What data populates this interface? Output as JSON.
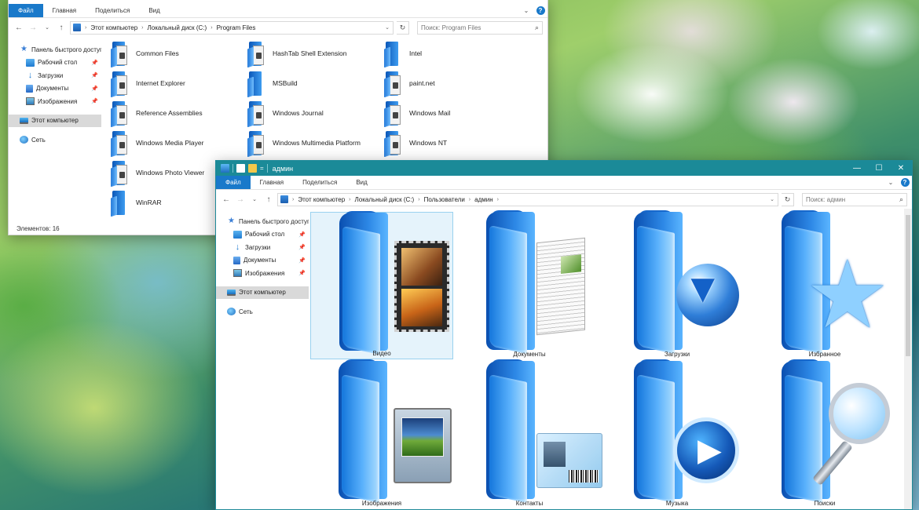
{
  "window1": {
    "tabs": [
      "Файл",
      "Главная",
      "Поделиться",
      "Вид"
    ],
    "path": [
      "Этот компьютер",
      "Локальный диск (C:)",
      "Program Files"
    ],
    "search_placeholder": "Поиск: Program Files",
    "nav": {
      "quick_access": "Панель быстрого доступа",
      "desktop": "Рабочий стол",
      "downloads": "Загрузки",
      "documents": "Документы",
      "pictures": "Изображения",
      "this_pc": "Этот компьютер",
      "network": "Сеть"
    },
    "items": [
      "Common Files",
      "HashTab Shell Extension",
      "Intel",
      "Internet Explorer",
      "MSBuild",
      "paint.net",
      "Reference Assemblies",
      "Windows Journal",
      "Windows Mail",
      "Windows Media Player",
      "Windows Multimedia Platform",
      "Windows NT",
      "Windows Photo Viewer",
      "WinRAR"
    ],
    "status": "Элементов: 16"
  },
  "window2": {
    "title": "админ",
    "tabs": [
      "Файл",
      "Главная",
      "Поделиться",
      "Вид"
    ],
    "path": [
      "Этот компьютер",
      "Локальный диск (C:)",
      "Пользователи",
      "админ"
    ],
    "search_placeholder": "Поиск: админ",
    "nav": {
      "quick_access": "Панель быстрого доступа",
      "desktop": "Рабочий стол",
      "downloads": "Загрузки",
      "documents": "Документы",
      "pictures": "Изображения",
      "this_pc": "Этот компьютер",
      "network": "Сеть"
    },
    "items": [
      "Видео",
      "Документы",
      "Загрузки",
      "Избранное",
      "Изображения",
      "Контакты",
      "Музыка",
      "Поиски"
    ]
  },
  "colors": {
    "titlebar": "#1b8a98",
    "file_tab": "#1979ca",
    "selection": "#e5f3fb",
    "nav_selected": "#d9d9d9"
  }
}
